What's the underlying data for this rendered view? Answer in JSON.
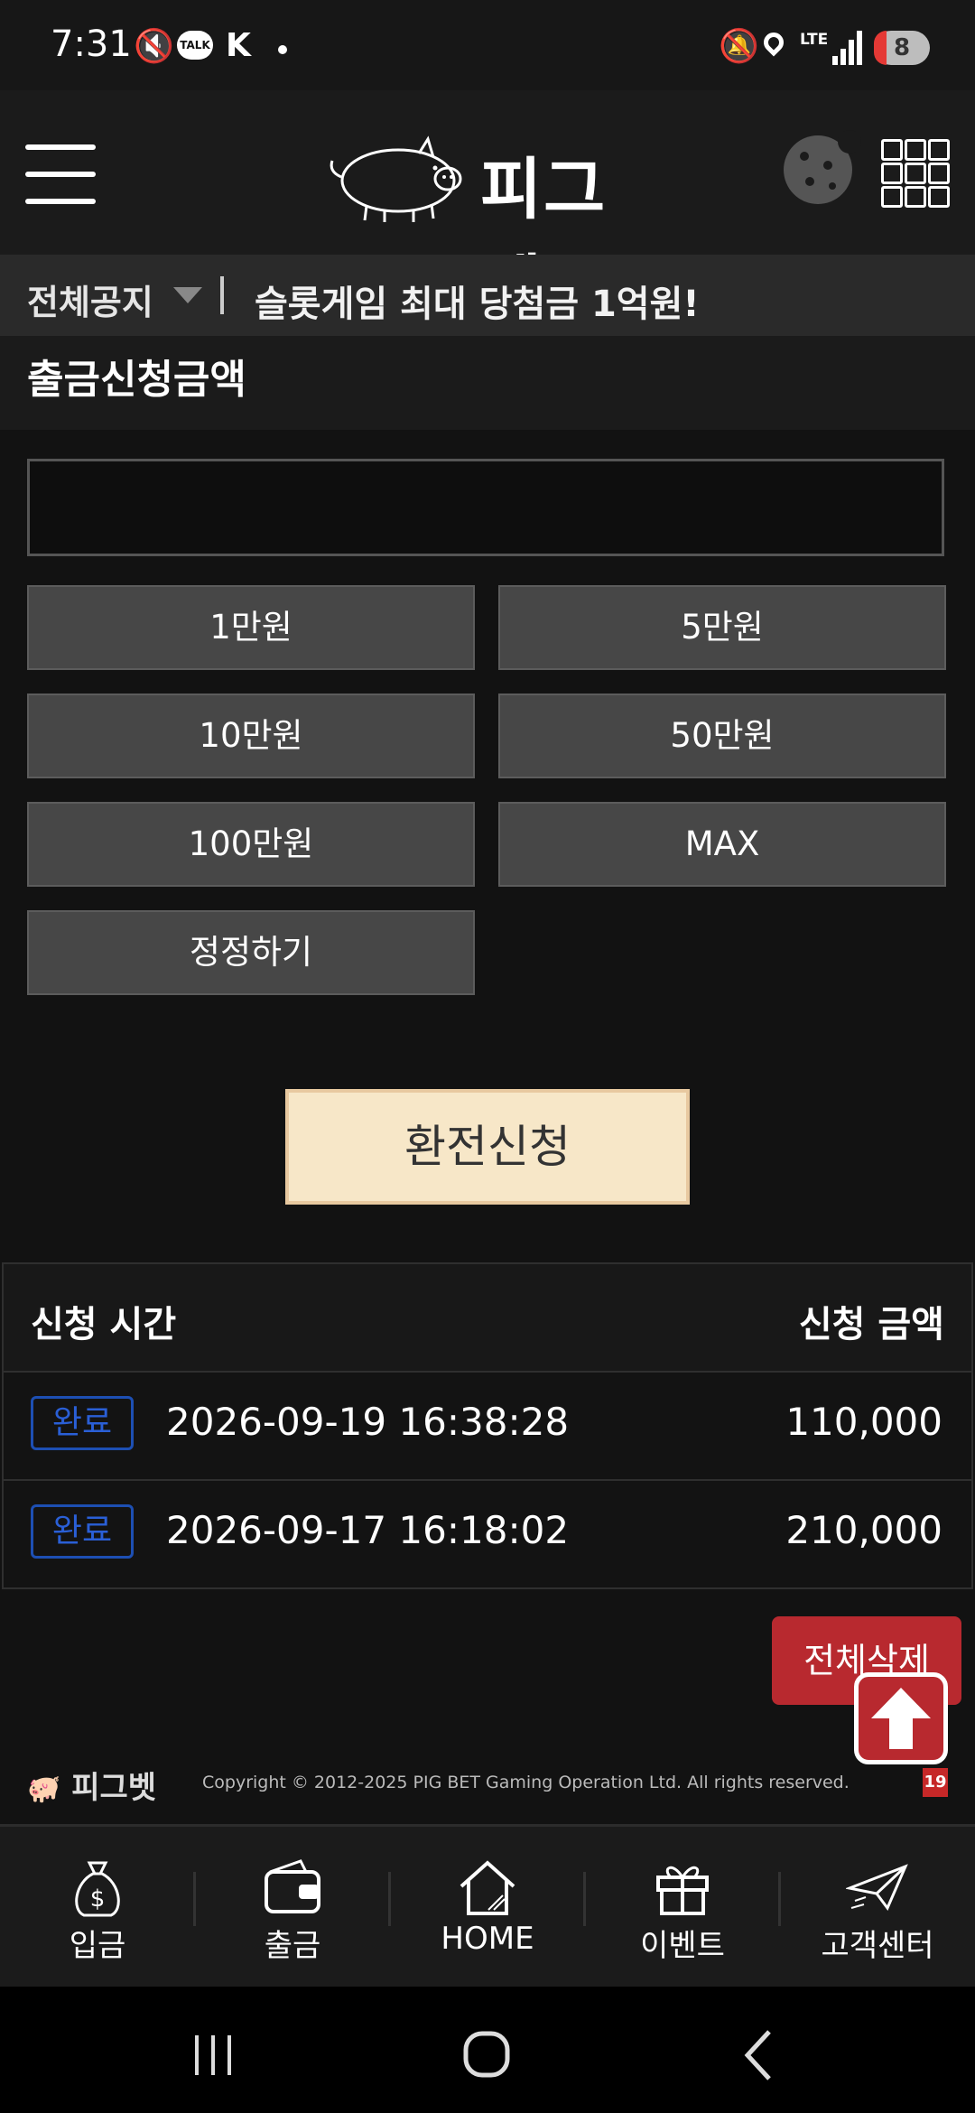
{
  "status_bar": {
    "time": "7:31",
    "network": "LTE",
    "battery": "8"
  },
  "header": {
    "brand": "피그벳"
  },
  "notice": {
    "label": "전체공지",
    "text": "슬롯게임 최대 당첨금 1억원!"
  },
  "withdraw": {
    "title": "출금신청금액",
    "input_value": "",
    "amount_buttons": [
      "1만원",
      "5만원",
      "10만원",
      "50만원",
      "100만원",
      "MAX"
    ],
    "reset_label": "정정하기",
    "submit_label": "환전신청"
  },
  "history": {
    "columns": [
      "신청 시간",
      "신청 금액"
    ],
    "rows": [
      {
        "status": "완료",
        "time": "2026-09-19 16:38:28",
        "amount": "110,000"
      },
      {
        "status": "완료",
        "time": "2026-09-17 16:18:02",
        "amount": "210,000"
      }
    ],
    "delete_all_label": "전체삭제"
  },
  "footer": {
    "brand": "피그벳",
    "copyright": "Copyright © 2012-2025 PIG BET Gaming Operation Ltd. All rights reserved.",
    "age_badge": "19"
  },
  "bottom_nav": [
    {
      "label": "입금",
      "icon": "money-bag-icon"
    },
    {
      "label": "출금",
      "icon": "wallet-icon"
    },
    {
      "label": "HOME",
      "icon": "home-icon"
    },
    {
      "label": "이벤트",
      "icon": "gift-icon"
    },
    {
      "label": "고객센터",
      "icon": "paper-plane-icon"
    }
  ],
  "colors": {
    "accent_red": "#b8292f",
    "submit_bg": "#f7e7c8",
    "badge_blue": "#2a5fd6"
  }
}
